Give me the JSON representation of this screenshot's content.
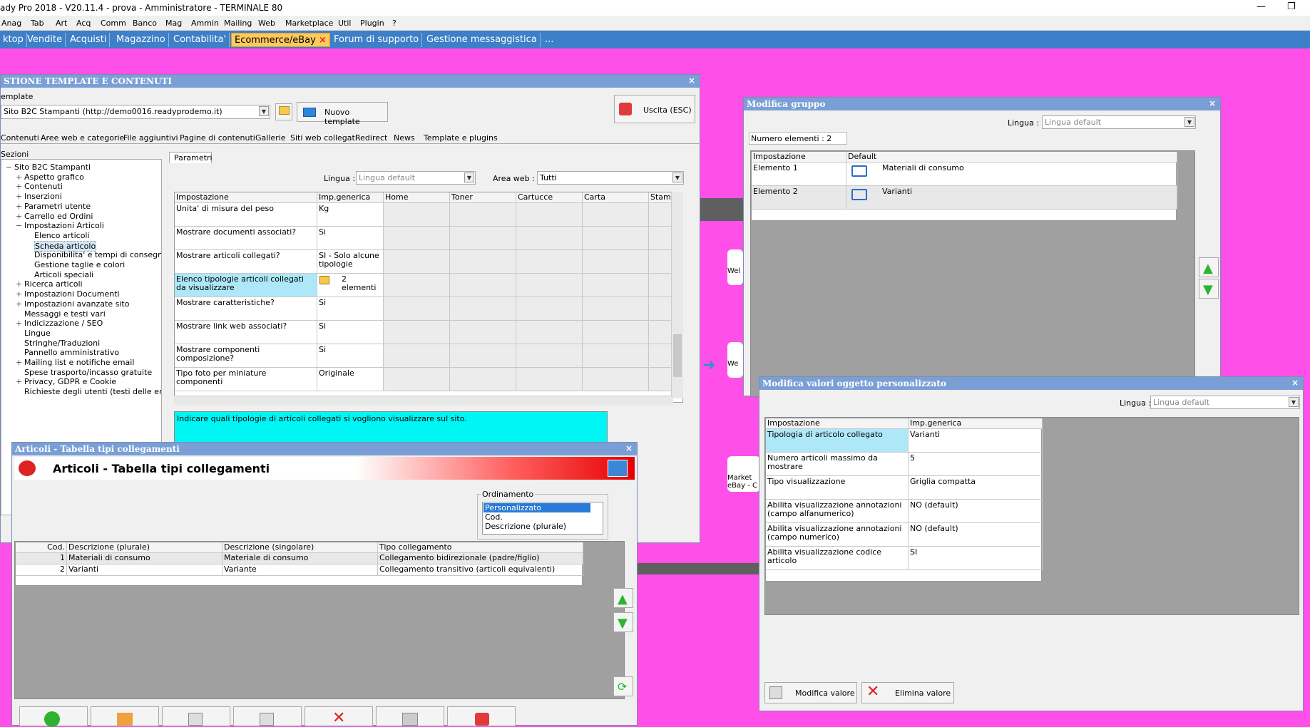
{
  "window": {
    "title": "ady Pro 2018 - V20.11.4 - prova - Amministratore - TERMINALE 80",
    "min": "—",
    "max": "❐"
  },
  "menu": [
    "Anag",
    "Tab",
    "Art",
    "Acq",
    "Comm",
    "Banco",
    "Mag",
    "Ammin",
    "Mailing",
    "Web",
    "Marketplace",
    "Util",
    "Plugin",
    "?"
  ],
  "module_tabs": [
    {
      "label": "ktop",
      "active": false
    },
    {
      "label": "Vendite",
      "active": false
    },
    {
      "label": "Acquisti",
      "active": false
    },
    {
      "label": "Magazzino",
      "active": false
    },
    {
      "label": "Contabilita'",
      "active": false
    },
    {
      "label": "Ecommerce/eBay",
      "active": true,
      "close": "×"
    },
    {
      "label": "Forum di supporto",
      "active": false
    },
    {
      "label": "Gestione messaggistica",
      "active": false
    },
    {
      "label": "...",
      "active": false
    }
  ],
  "tmpl_win": {
    "title": "STIONE TEMPLATE E CONTENUTI",
    "close": "×",
    "template_label": "emplate",
    "template_value": "Sito B2C Stampanti (http://demo0016.readyprodemo.it)",
    "new_template": "Nuovo template",
    "exit": "Uscita (ESC)",
    "tabs": [
      "Contenuti",
      "Aree web e categorie",
      "File aggiuntivi",
      "Pagine di contenuti",
      "Gallerie",
      "Siti web collegati",
      "Redirect",
      "News",
      "Template e plugins"
    ],
    "sections_label": "Sezioni",
    "tree": [
      {
        "text": "Sito B2C Stampanti",
        "level": 0,
        "exp": "−"
      },
      {
        "text": "Aspetto grafico",
        "level": 1,
        "exp": "+"
      },
      {
        "text": "Contenuti",
        "level": 1,
        "exp": "+"
      },
      {
        "text": "Inserzioni",
        "level": 1,
        "exp": "+"
      },
      {
        "text": "Parametri utente",
        "level": 1,
        "exp": "+"
      },
      {
        "text": "Carrello ed Ordini",
        "level": 1,
        "exp": "+"
      },
      {
        "text": "Impostazioni Articoli",
        "level": 1,
        "exp": "−"
      },
      {
        "text": "Elenco articoli",
        "level": 2,
        "exp": ""
      },
      {
        "text": "Scheda articolo",
        "level": 2,
        "exp": "",
        "selected": true
      },
      {
        "text": "Disponibilita' e tempi di consegna",
        "level": 2,
        "exp": ""
      },
      {
        "text": "Gestione taglie e colori",
        "level": 2,
        "exp": ""
      },
      {
        "text": "Articoli speciali",
        "level": 2,
        "exp": ""
      },
      {
        "text": "Ricerca articoli",
        "level": 1,
        "exp": "+"
      },
      {
        "text": "Impostazioni Documenti",
        "level": 1,
        "exp": "+"
      },
      {
        "text": "Impostazioni avanzate sito",
        "level": 1,
        "exp": "+"
      },
      {
        "text": "Messaggi e testi vari",
        "level": 1,
        "exp": ""
      },
      {
        "text": "Indicizzazione / SEO",
        "level": 1,
        "exp": "+"
      },
      {
        "text": "Lingue",
        "level": 1,
        "exp": ""
      },
      {
        "text": "Stringhe/Traduzioni",
        "level": 1,
        "exp": ""
      },
      {
        "text": "Pannello amministrativo",
        "level": 1,
        "exp": ""
      },
      {
        "text": "Mailing list e notifiche email",
        "level": 1,
        "exp": "+"
      },
      {
        "text": "Spese trasporto/incasso gratuite",
        "level": 1,
        "exp": ""
      },
      {
        "text": "Privacy, GDPR e Cookie",
        "level": 1,
        "exp": "+"
      },
      {
        "text": "Richieste degli utenti (testi delle email)",
        "level": 1,
        "exp": ""
      }
    ],
    "params_tab": "Parametri",
    "lingua_label": "Lingua :",
    "lingua_value": "Lingua default",
    "area_label": "Area web :",
    "area_value": "Tutti",
    "columns": [
      "Impostazione",
      "Imp.generica",
      "Home",
      "Toner",
      "Cartucce",
      "Carta Fotografica",
      "Stamp"
    ],
    "rows": [
      {
        "name": "Unita' di misura del peso",
        "value": "Kg"
      },
      {
        "name": "Mostrare documenti associati?",
        "value": "Si"
      },
      {
        "name": "Mostrare articoli collegati?",
        "value": "SI - Solo alcune tipologie"
      },
      {
        "name": "Elenco tipologie articoli collegati da visualizzare",
        "value": "2 elementi",
        "selected": true
      },
      {
        "name": "Mostrare caratteristiche?",
        "value": "Si"
      },
      {
        "name": "Mostrare link web associati?",
        "value": "Si"
      },
      {
        "name": "Mostrare componenti composizione?",
        "value": "Si"
      },
      {
        "name": "Tipo foto per miniature componenti",
        "value": "Originale"
      }
    ],
    "description": "Indicare quali tipologie di articoli collegati si vogliono visualizzare sul sito."
  },
  "art_win": {
    "title": "Articoli - Tabella tipi collegamenti",
    "close": "×",
    "header": "Articoli - Tabella tipi collegamenti",
    "order_label": "Ordinamento",
    "order_options": [
      "Personalizzato",
      "Cod.",
      "Descrizione (plurale)"
    ],
    "columns": [
      "Cod.",
      "Descrizione (plurale)",
      "Descrizione (singolare)",
      "Tipo collegamento"
    ],
    "rows": [
      {
        "cod": "1",
        "plur": "Materiali di consumo",
        "sing": "Materiale di consumo",
        "tipo": "Collegamento bidirezionale (padre/figlio)"
      },
      {
        "cod": "2",
        "plur": "Varianti",
        "sing": "Variante",
        "tipo": "Collegamento transitivo (articoli equivalenti)"
      }
    ]
  },
  "group_win": {
    "title": "Modifica gruppo",
    "close": "×",
    "lingua_label": "Lingua :",
    "lingua_value": "Lingua default",
    "count": "Numero elementi : 2",
    "columns": [
      "Impostazione",
      "Default"
    ],
    "rows": [
      {
        "name": "Elemento 1",
        "value": "Materiali di consumo"
      },
      {
        "name": "Elemento 2",
        "value": "Varianti"
      }
    ]
  },
  "custom_win": {
    "title": "Modifica valori oggetto personalizzato",
    "close": "×",
    "lingua_label": "Lingua :",
    "lingua_value": "Lingua default",
    "columns": [
      "Impostazione",
      "Imp.generica"
    ],
    "rows": [
      {
        "name": "Tipologia di articolo collegato",
        "value": "Varianti",
        "selected": true
      },
      {
        "name": "Numero articoli massimo da mostrare",
        "value": "5"
      },
      {
        "name": "Tipo visualizzazione",
        "value": "Griglia compatta"
      },
      {
        "name": "Abilita visualizzazione annotazioni (campo alfanumerico)",
        "value": "NO (default)"
      },
      {
        "name": "Abilita visualizzazione annotazioni (campo numerico)",
        "value": "NO (default)"
      },
      {
        "name": "Abilita visualizzazione codice articolo",
        "value": "SI"
      }
    ],
    "edit_btn": "Modifica valore",
    "delete_btn": "Elimina valore"
  },
  "bg_tiles": [
    "Wel",
    "We",
    "Market",
    "eBay - C"
  ]
}
